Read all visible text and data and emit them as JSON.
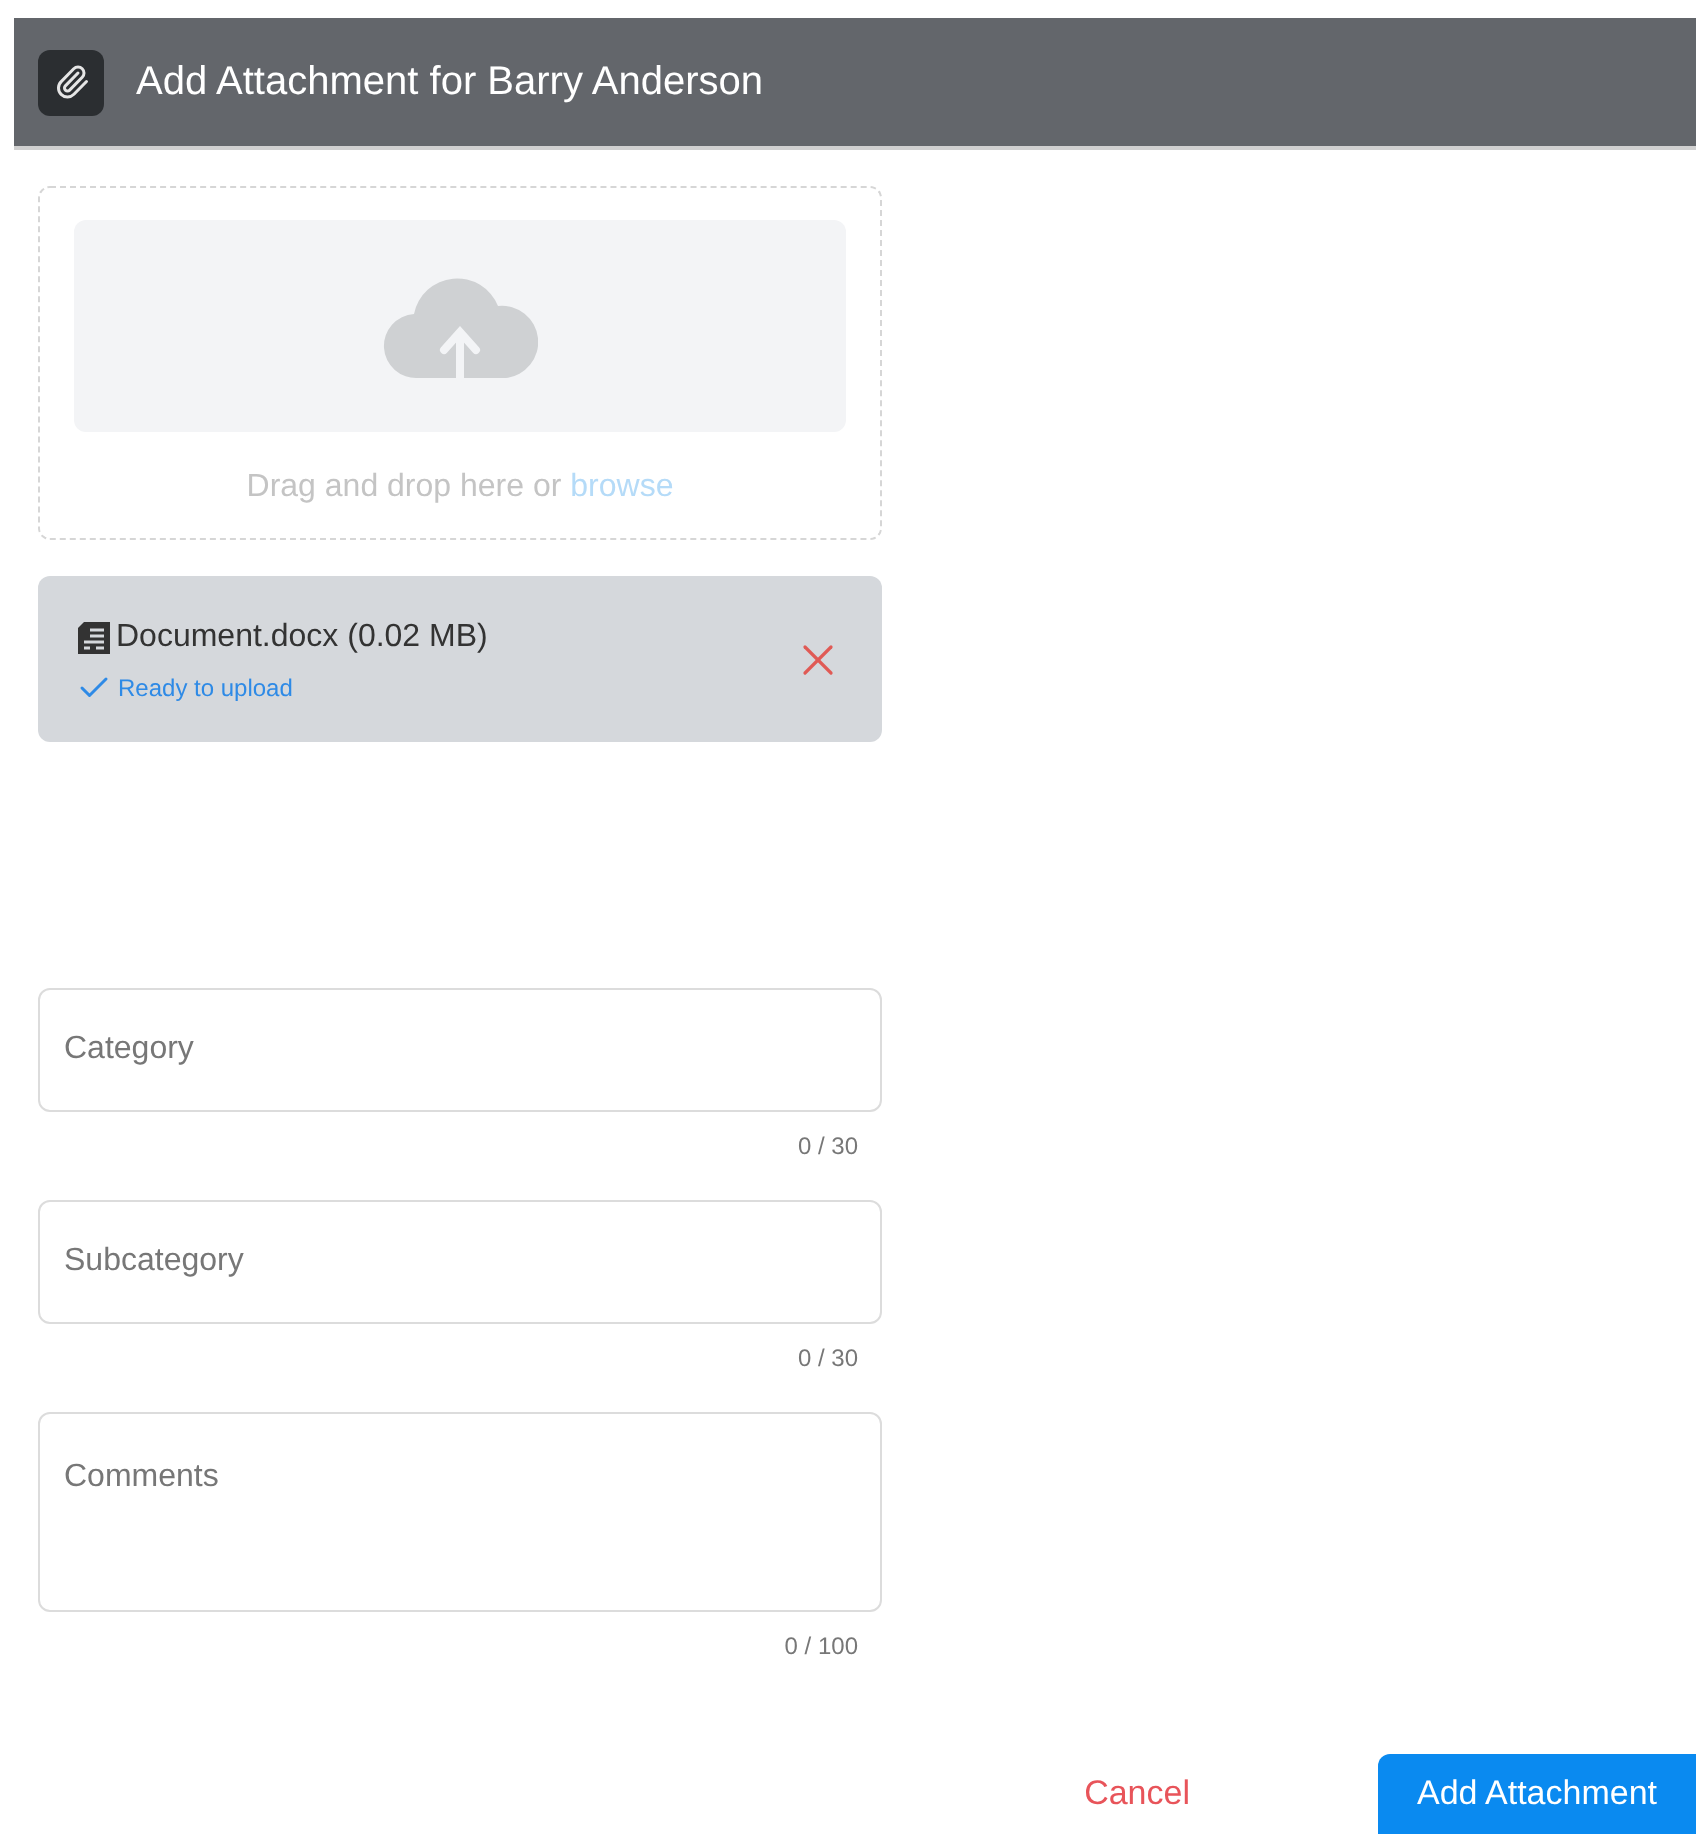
{
  "header": {
    "title": "Add Attachment for Barry Anderson"
  },
  "upload": {
    "prompt": "Drag and drop here or",
    "link": "browse"
  },
  "file": {
    "name": "Document.docx (0.02 MB)",
    "status": "Ready to upload"
  },
  "fields": [
    {
      "kind": "input",
      "placeholder": "Category",
      "counter": "0 / 30"
    },
    {
      "kind": "input",
      "placeholder": "Subcategory",
      "counter": "0 / 30"
    },
    {
      "kind": "textarea",
      "placeholder": "Comments",
      "counter": "0 / 100"
    }
  ],
  "actions": {
    "cancel": "Cancel",
    "submit": "Add Attachment"
  }
}
